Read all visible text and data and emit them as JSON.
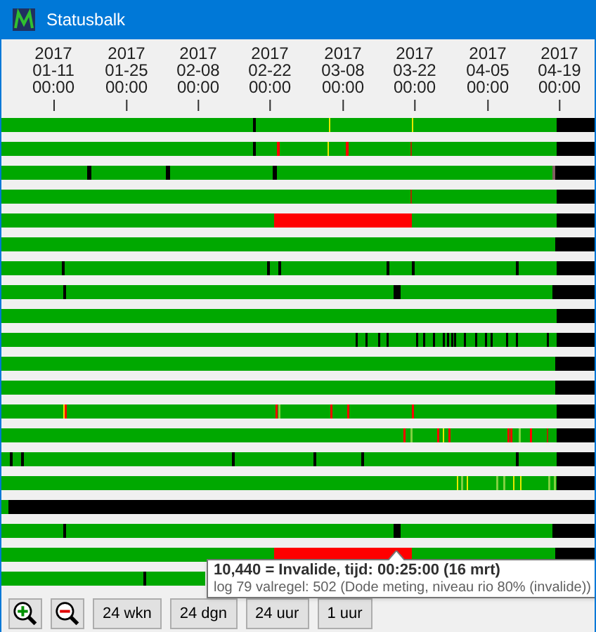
{
  "window": {
    "title": "Statusbalk"
  },
  "timeline_ticks": [
    {
      "year": "2017",
      "date": "01-11",
      "time": "00:00"
    },
    {
      "year": "2017",
      "date": "01-25",
      "time": "00:00"
    },
    {
      "year": "2017",
      "date": "02-08",
      "time": "00:00"
    },
    {
      "year": "2017",
      "date": "02-22",
      "time": "00:00"
    },
    {
      "year": "2017",
      "date": "03-08",
      "time": "00:00"
    },
    {
      "year": "2017",
      "date": "03-22",
      "time": "00:00"
    },
    {
      "year": "2017",
      "date": "04-05",
      "time": "00:00"
    },
    {
      "year": "2017",
      "date": "04-19",
      "time": "00:00"
    }
  ],
  "tooltip": {
    "title": "10,440 = Invalide, tijd: 00:25:00 (16 mrt)",
    "detail": "log 79 valregel: 502 (Dode meting, niveau rio 80% (invalide))"
  },
  "toolbar": [
    {
      "kind": "zoom_in"
    },
    {
      "kind": "zoom_out"
    },
    {
      "kind": "text",
      "label": "24 wkn"
    },
    {
      "kind": "text",
      "label": "24 dgn"
    },
    {
      "kind": "text",
      "label": "24 uur"
    },
    {
      "kind": "text",
      "label": "1 uur"
    }
  ]
}
